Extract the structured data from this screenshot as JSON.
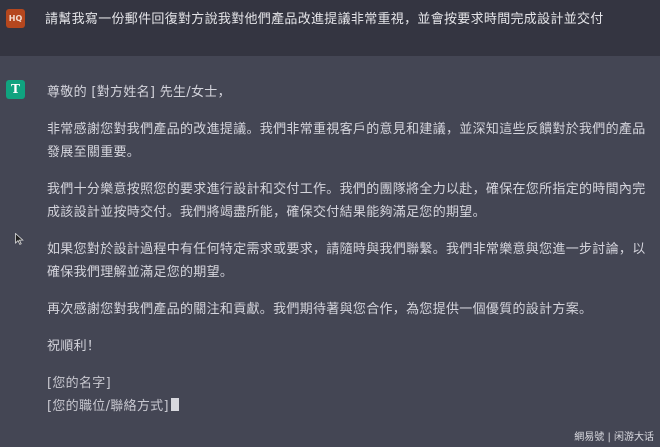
{
  "user_message": {
    "avatar_text": "HQ",
    "text": "請幫我寫一份郵件回復對方說我對他們產品改進提議非常重視，並會按要求時間完成設計並交付"
  },
  "assistant_message": {
    "avatar_text": "T",
    "paragraphs": [
      "尊敬的 [對方姓名] 先生/女士，",
      "非常感謝您對我們產品的改進提議。我們非常重視客戶的意見和建議，並深知這些反饋對於我們的產品發展至關重要。",
      "我們十分樂意按照您的要求進行設計和交付工作。我們的團隊將全力以赴，確保在您所指定的時間內完成該設計並按時交付。我們將竭盡所能，確保交付結果能夠滿足您的期望。",
      "如果您對於設計過程中有任何特定需求或要求，請隨時與我們聯繫。我們非常樂意與您進一步討論，以確保我們理解並滿足您的期望。",
      "再次感謝您對我們產品的關注和貢獻。我們期待著與您合作，為您提供一個優質的設計方案。",
      "祝順利！"
    ],
    "signature_name": "[您的名字]",
    "signature_title": "[您的職位/聯絡方式]"
  },
  "watermark": "網易號 | 闲游大话",
  "colors": {
    "user_row_bg": "#343541",
    "assistant_row_bg": "#444654",
    "user_avatar": "#b5471e",
    "assistant_avatar": "#10a37f"
  }
}
